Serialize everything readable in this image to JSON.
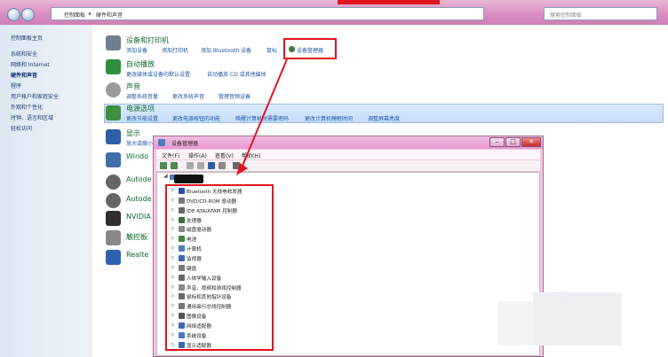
{
  "window": {
    "breadcrumb": [
      "控制面板",
      "硬件和声音"
    ],
    "search_placeholder": "搜索控制面板"
  },
  "leftnav": {
    "items": [
      {
        "label": "控制面板主页",
        "bold": false
      },
      {
        "label": "系统和安全",
        "bold": false
      },
      {
        "label": "网络和 Internet",
        "bold": false
      },
      {
        "label": "硬件和声音",
        "bold": true
      },
      {
        "label": "程序",
        "bold": false
      },
      {
        "label": "用户帐户和家庭安全",
        "bold": false
      },
      {
        "label": "外观和个性化",
        "bold": false
      },
      {
        "label": "时钟、语言和区域",
        "bold": false
      },
      {
        "label": "轻松访问",
        "bold": false
      }
    ]
  },
  "categories": [
    {
      "title": "设备和打印机",
      "links": [
        "添加设备",
        "添加打印机",
        "添加 Bluetooth 设备",
        "鼠标"
      ],
      "color": "#6f7f8f"
    },
    {
      "title": "自动播放",
      "links": [
        "更改媒体或设备的默认设置",
        "自动播放 CD 或其他媒体"
      ],
      "color": "#2f8f3f"
    },
    {
      "title": "声音",
      "links": [
        "调整系统音量",
        "更改系统声音",
        "管理音频设备"
      ],
      "color": "#9a9a9a"
    },
    {
      "title": "电源选项",
      "links": [
        "更改节能设置",
        "更改电源按钮的功能",
        "唤醒计算机时需要密码",
        "更改计算机睡眠时间",
        "调整屏幕亮度"
      ],
      "color": "#3f8f3f"
    },
    {
      "title": "显示",
      "links": [
        "放大或缩小文本和其他项目"
      ],
      "color": "#2d5fa8"
    }
  ],
  "devmgr_link": "设备管理器",
  "partial_labels": [
    "Windo",
    "Autode",
    "Autode",
    "NVIDIA",
    "触控板",
    "Realte"
  ],
  "devmgr": {
    "title": "设备管理器",
    "menu": [
      "文件(F)",
      "操作(A)",
      "查看(V)",
      "帮助(H)"
    ],
    "items": [
      {
        "label": "Bluetooth 无线电收发器",
        "color": "#2b4ea8"
      },
      {
        "label": "DVD/CD-ROM 驱动器",
        "color": "#777"
      },
      {
        "label": "IDE ATA/ATAPI 控制器",
        "color": "#666"
      },
      {
        "label": "处理器",
        "color": "#3a6e3a"
      },
      {
        "label": "磁盘驱动器",
        "color": "#888"
      },
      {
        "label": "电池",
        "color": "#3a8a3a"
      },
      {
        "label": "计算机",
        "color": "#4a7cc0"
      },
      {
        "label": "监视器",
        "color": "#3a6ab0"
      },
      {
        "label": "键盘",
        "color": "#777"
      },
      {
        "label": "人体学输入设备",
        "color": "#666"
      },
      {
        "label": "声音、视频和游戏控制器",
        "color": "#888"
      },
      {
        "label": "鼠标和其他指针设备",
        "color": "#666"
      },
      {
        "label": "通用串行总线控制器",
        "color": "#777"
      },
      {
        "label": "图像设备",
        "color": "#555"
      },
      {
        "label": "网络适配器",
        "color": "#3a6ab0"
      },
      {
        "label": "系统设备",
        "color": "#4a7cc0"
      },
      {
        "label": "显示适配器",
        "color": "#3a6ab0"
      }
    ]
  },
  "colors": {
    "highlight_red": "#e4141e",
    "link_blue": "#2056a8",
    "title_green": "#0b6b2f"
  }
}
